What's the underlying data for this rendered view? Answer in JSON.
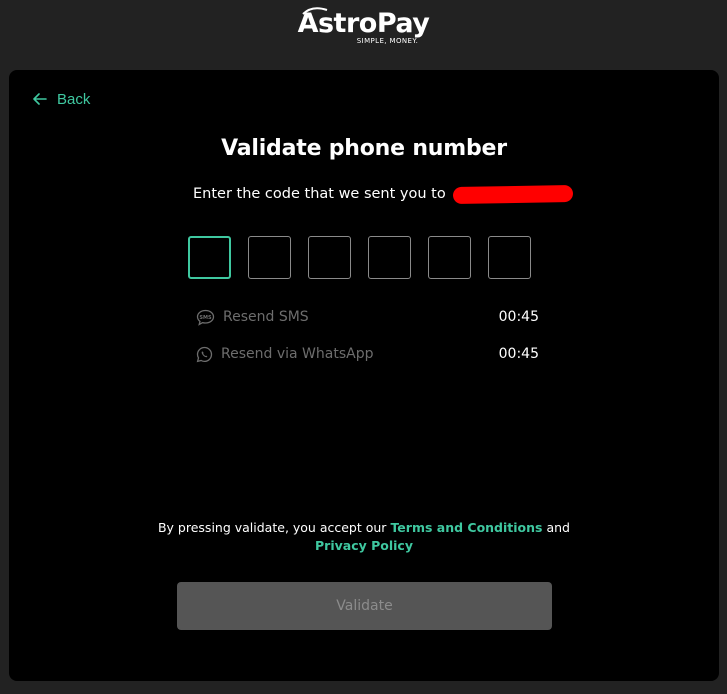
{
  "brand": {
    "name": "AstroPay",
    "tagline": "SIMPLE, MONEY."
  },
  "nav": {
    "back_label": "Back"
  },
  "page": {
    "title": "Validate phone number",
    "subtitle": "Enter the code that we sent you to"
  },
  "otp": {
    "digits": [
      "",
      "",
      "",
      "",
      "",
      ""
    ],
    "active_index": 0
  },
  "resend": {
    "sms_label": "Resend SMS",
    "sms_timer": "00:45",
    "whatsapp_label": "Resend via WhatsApp",
    "whatsapp_timer": "00:45"
  },
  "terms": {
    "prefix": "By pressing validate, you accept our",
    "terms_link": "Terms and Conditions",
    "conjunction": "and",
    "privacy_link": "Privacy Policy"
  },
  "actions": {
    "validate_label": "Validate",
    "validate_enabled": false
  },
  "colors": {
    "accent": "#3fc8a0",
    "background": "#000000",
    "page_background": "#222222",
    "button_disabled": "#555555",
    "redaction": "#ff0000"
  },
  "icons": {
    "back": "arrow-left-icon",
    "sms": "sms-bubble-icon",
    "whatsapp": "whatsapp-icon"
  }
}
